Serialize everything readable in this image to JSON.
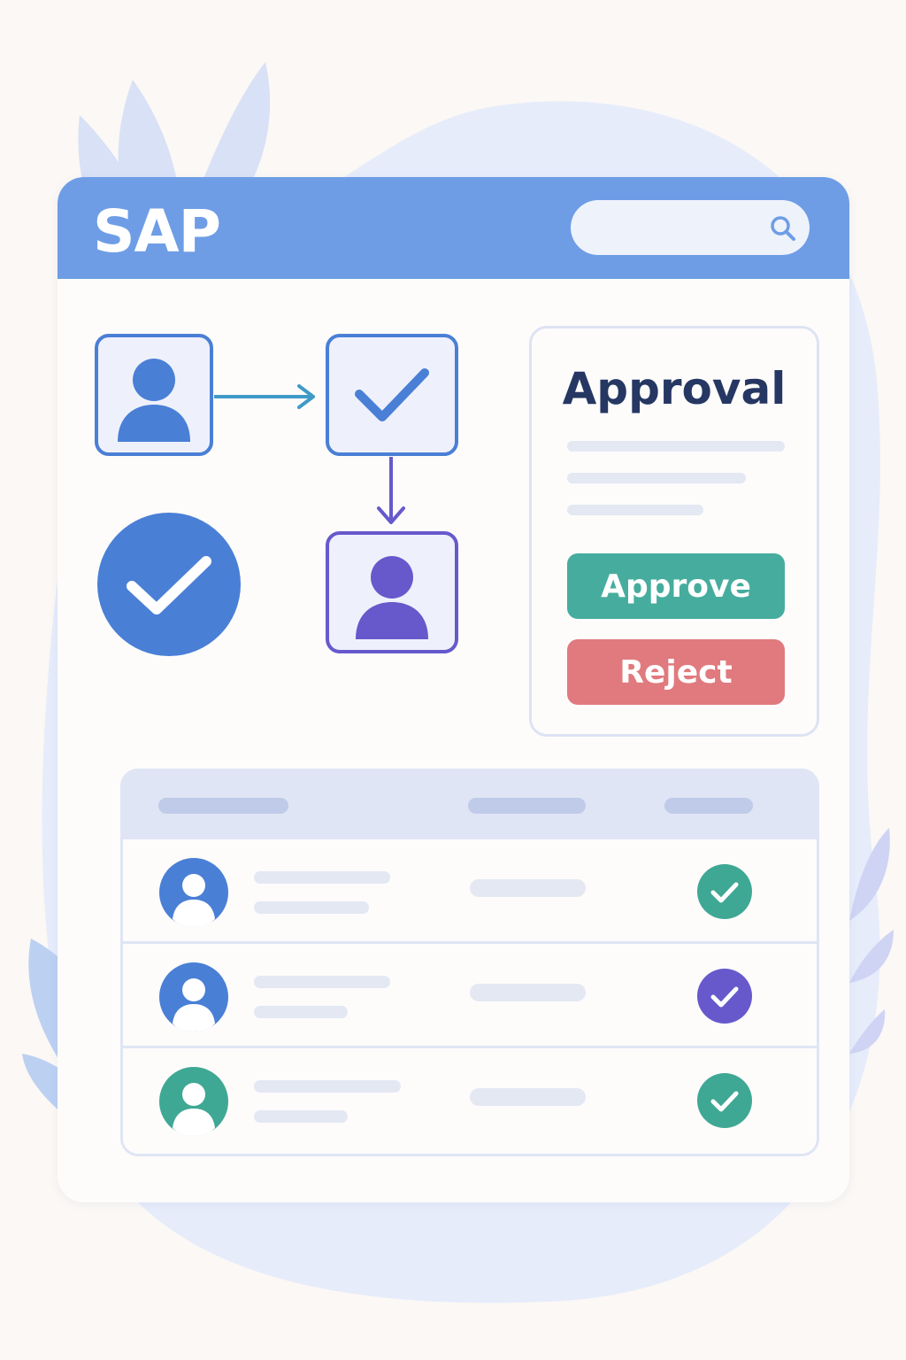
{
  "app": {
    "brand": "SAP",
    "search": {
      "placeholder": ""
    }
  },
  "approval_card": {
    "title": "Approval",
    "approve_label": "Approve",
    "reject_label": "Reject"
  },
  "table": {
    "rows": [
      {
        "avatar_color": "#4a7fd6",
        "status_color": "#3fa894"
      },
      {
        "avatar_color": "#4a7fd6",
        "status_color": "#6759cc"
      },
      {
        "avatar_color": "#3fa894",
        "status_color": "#3fa894"
      }
    ]
  },
  "colors": {
    "header": "#6e9de6",
    "primary": "#4a7fd6",
    "purple": "#6759cc",
    "teal": "#46ad9e",
    "red": "#e07a7e",
    "title": "#253762"
  },
  "icons": [
    "search-icon",
    "user-icon",
    "check-icon",
    "arrow-right-icon",
    "arrow-down-icon",
    "check-circle-icon"
  ]
}
